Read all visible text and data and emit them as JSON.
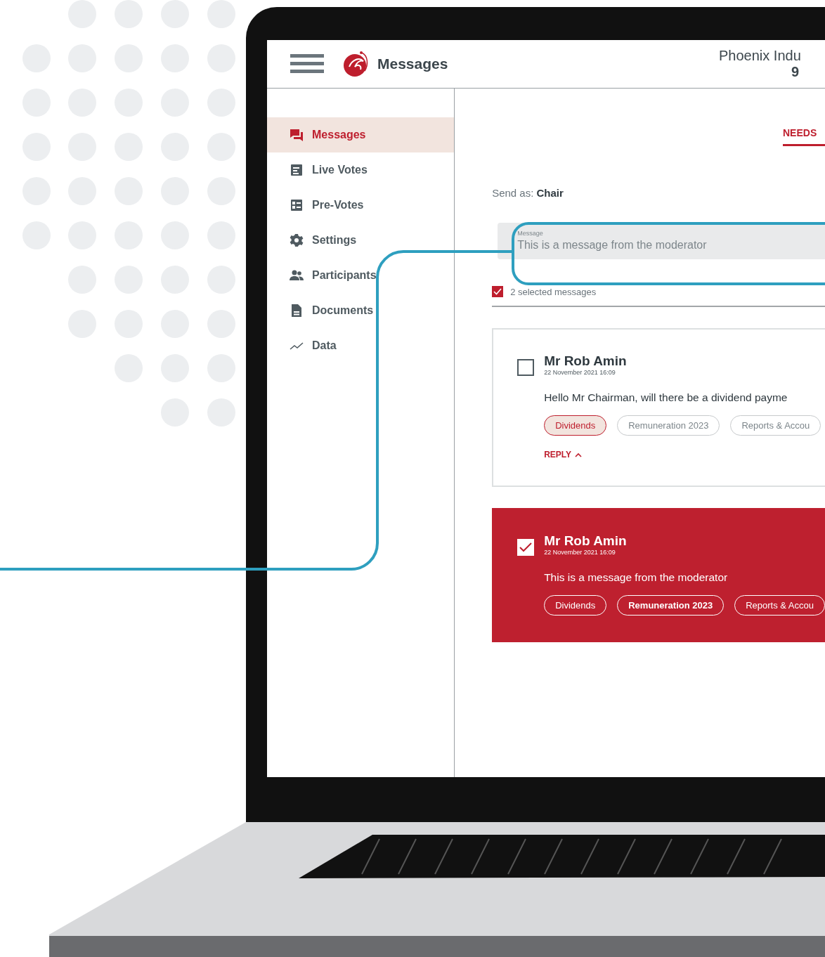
{
  "header": {
    "title": "Messages",
    "org_name": "Phoenix Indu",
    "org_line_2": "9"
  },
  "sidebar": {
    "items": [
      {
        "label": "Messages",
        "selected": true
      },
      {
        "label": "Live Votes",
        "selected": false
      },
      {
        "label": "Pre-Votes",
        "selected": false
      },
      {
        "label": "Settings",
        "selected": false
      },
      {
        "label": "Participants",
        "selected": false
      },
      {
        "label": "Documents",
        "selected": false
      },
      {
        "label": "Data",
        "selected": false
      }
    ]
  },
  "tabs": [
    {
      "label": "NEEDS",
      "selected": true
    }
  ],
  "send_as": "Send as: **Chair**",
  "message_field": {
    "label": "Message",
    "value": "This is a message from the moderator"
  },
  "select_all": {
    "checked": true,
    "label": "2 selected messages"
  },
  "messages": [
    {
      "author": "Mr Rob Amin",
      "timestamp": "22 November 2021 16:09",
      "text": "Hello Mr Chairman, will there be a dividend payme",
      "selected": false,
      "tags": [
        {
          "label": "Dividends",
          "selected": true
        },
        {
          "label": "Remuneration 2023",
          "selected": false
        },
        {
          "label": "Reports & Accou",
          "selected": false
        }
      ],
      "reply_label": "REPLY"
    },
    {
      "author": "Mr Rob Amin",
      "timestamp": "22 November 2021 16:09",
      "text": "This is a message from the moderator",
      "selected": true,
      "tags": [
        {
          "label": "Dividends",
          "selected": false
        },
        {
          "label": "Remuneration 2023",
          "selected": true
        },
        {
          "label": "Reports & Accou",
          "selected": false
        }
      ]
    }
  ]
}
